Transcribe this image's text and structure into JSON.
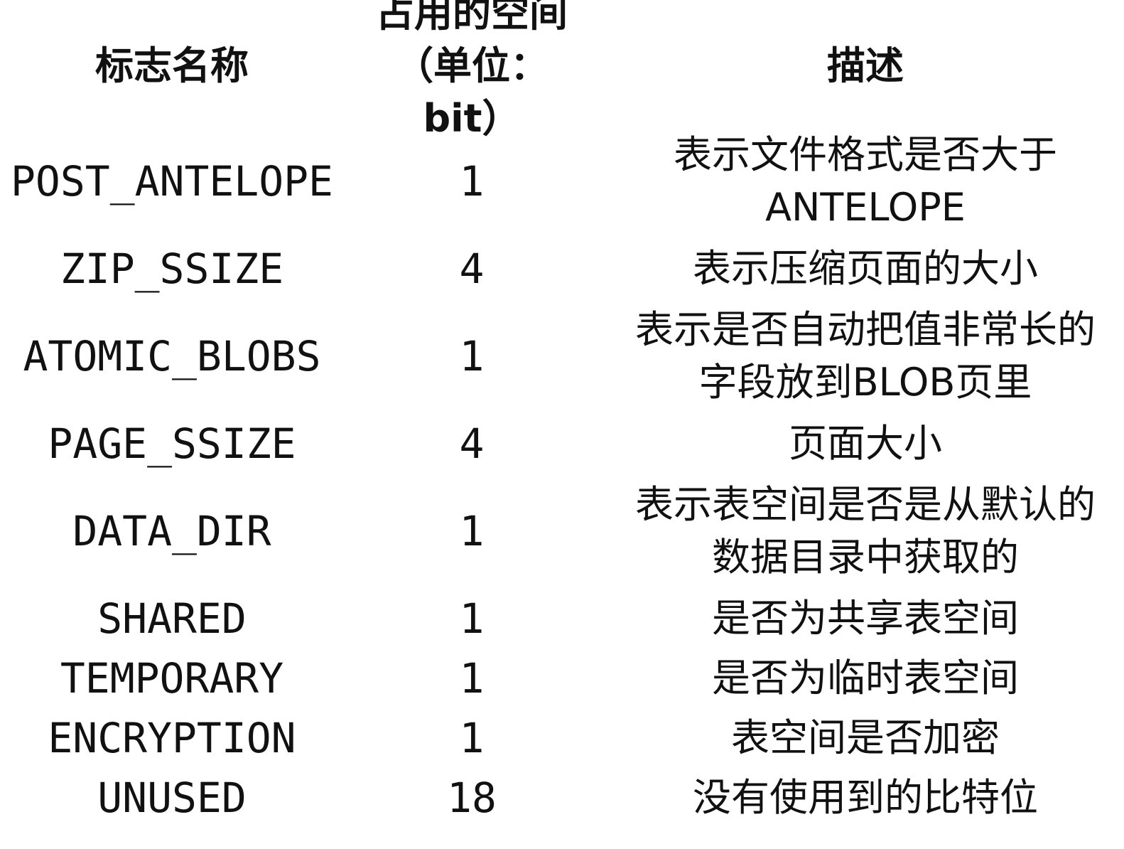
{
  "header": {
    "name": "标志名称",
    "size_line1": "占用的空间",
    "size_line2": "（单位：bit）",
    "desc": "描述"
  },
  "rows": [
    {
      "name": "POST_ANTELOPE",
      "size": "1",
      "desc_line1": "表示文件格式是否大于",
      "desc_line2": "ANTELOPE"
    },
    {
      "name": "ZIP_SSIZE",
      "size": "4",
      "desc_line1": "表示压缩页面的大小",
      "desc_line2": ""
    },
    {
      "name": "ATOMIC_BLOBS",
      "size": "1",
      "desc_line1": "表示是否自动把值非常长的",
      "desc_line2": "字段放到BLOB页里"
    },
    {
      "name": "PAGE_SSIZE",
      "size": "4",
      "desc_line1": "页面大小",
      "desc_line2": ""
    },
    {
      "name": "DATA_DIR",
      "size": "1",
      "desc_line1": "表示表空间是否是从默认的",
      "desc_line2": "数据目录中获取的"
    },
    {
      "name": "SHARED",
      "size": "1",
      "desc_line1": "是否为共享表空间",
      "desc_line2": ""
    },
    {
      "name": "TEMPORARY",
      "size": "1",
      "desc_line1": "是否为临时表空间",
      "desc_line2": ""
    },
    {
      "name": "ENCRYPTION",
      "size": "1",
      "desc_line1": "表空间是否加密",
      "desc_line2": ""
    },
    {
      "name": "UNUSED",
      "size": "18",
      "desc_line1": "没有使用到的比特位",
      "desc_line2": ""
    }
  ]
}
